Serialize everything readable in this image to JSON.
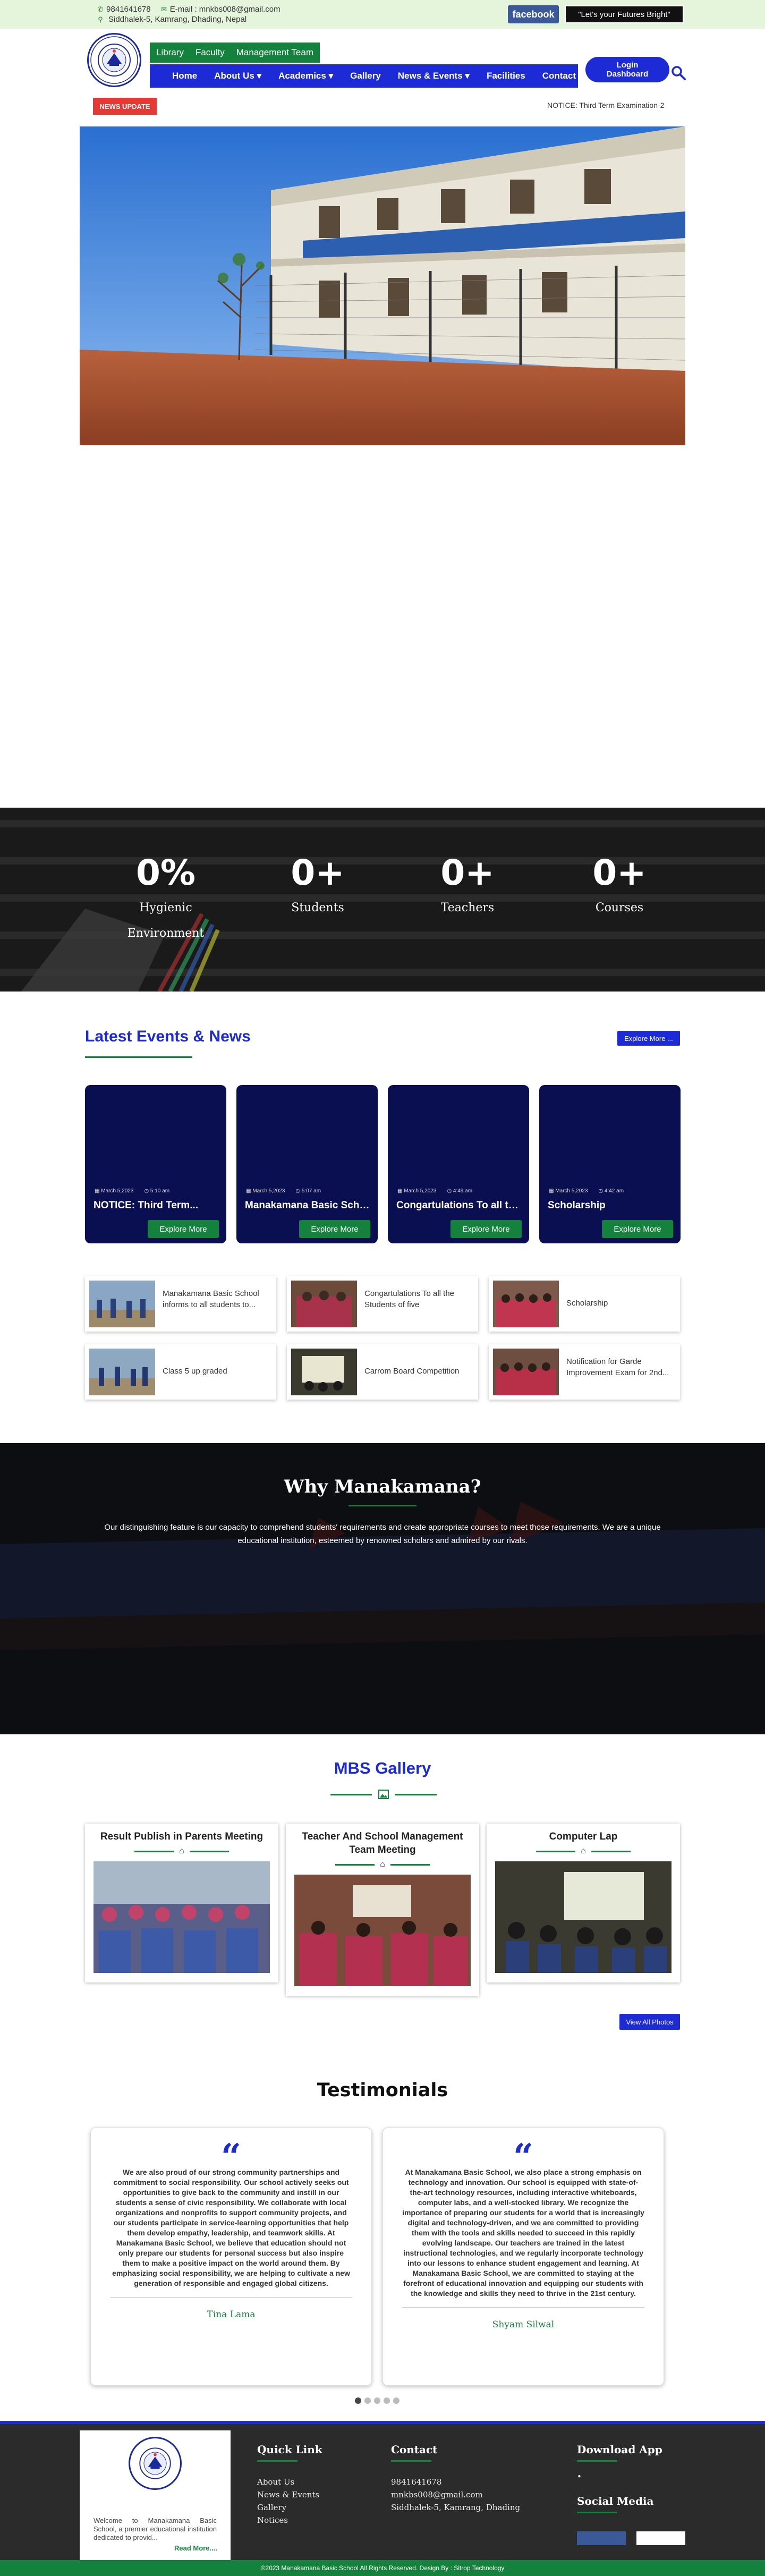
{
  "topbar": {
    "phone": "9841641678",
    "email": "E-mail : mnkbs008@gmail.com",
    "address": "Siddhalek-5, Kamrang, Dhading, Nepal",
    "facebook_label": "facebook",
    "slogan": "\"Let's your Futures Bright\""
  },
  "subnav": [
    "Library",
    "Faculty",
    "Management Team"
  ],
  "mainnav": [
    "Home",
    "About Us",
    "Academics",
    "Gallery",
    "News & Events",
    "Facilities",
    "Contact"
  ],
  "mainnav_dropdown_marker": "▾",
  "login_label": "Login Dashboard",
  "news": {
    "label": "NEWS UPDATE",
    "ticker": "NOTICE: Third Term Examination-2"
  },
  "stats": [
    {
      "value": "0%",
      "label": "Hygienic Environment"
    },
    {
      "value": "0+",
      "label": "Students"
    },
    {
      "value": "0+",
      "label": "Teachers"
    },
    {
      "value": "0+",
      "label": "Courses"
    }
  ],
  "events": {
    "title": "Latest Events & News",
    "explore_all": "Explore More ...",
    "cards": [
      {
        "date": "March 5,2023",
        "time": "5:10 am",
        "title": "NOTICE: Third Term...",
        "button": "Explore More"
      },
      {
        "date": "March 5,2023",
        "time": "5:07 am",
        "title": "Manakamana Basic School...",
        "button": "Explore More"
      },
      {
        "date": "March 5,2023",
        "time": "4:49 am",
        "title": "Congartulations To all the...",
        "button": "Explore More"
      },
      {
        "date": "March 5,2023",
        "time": "4:42 am",
        "title": "Scholarship",
        "button": "Explore More"
      }
    ],
    "mini": [
      "Manakamana Basic School informs to all students to...",
      "Congartulations To all the Students of five",
      "Scholarship",
      "Class 5 up graded",
      "Carrom Board Competition",
      "Notification for Garde Improvement Exam for 2nd..."
    ]
  },
  "why": {
    "title": "Why Manakamana?",
    "text": "Our distinguishing feature is our capacity to comprehend students' requirements and create appropriate courses to meet those requirements. We are a unique educational institution, esteemed by renowned scholars and admired by our rivals."
  },
  "gallery": {
    "title": "MBS Gallery",
    "cards": [
      "Result Publish in Parents Meeting",
      "Teacher And School Management Team Meeting",
      "Computer Lap"
    ],
    "view_all": "View All Photos"
  },
  "testimonials": {
    "title": "Testimonials",
    "items": [
      {
        "text": "We are also proud of our strong community partnerships and commitment to social responsibility. Our school actively seeks out opportunities to give back to the community and instill in our students a sense of civic responsibility. We collaborate with local organizations and nonprofits to support community projects, and our students participate in service-learning opportunities that help them develop empathy, leadership, and teamwork skills. At Manakamana Basic School, we believe that education should not only prepare our students for personal success but also inspire them to make a positive impact on the world around them. By emphasizing social responsibility, we are helping to cultivate a new generation of responsible and engaged global citizens.",
        "name": "Tina Lama"
      },
      {
        "text": "At Manakamana Basic School, we also place a strong emphasis on technology and innovation. Our school is equipped with state-of-the-art technology resources, including interactive whiteboards, computer labs, and a well-stocked library. We recognize the importance of preparing our students for a world that is increasingly digital and technology-driven, and we are committed to providing them with the tools and skills needed to succeed in this rapidly evolving landscape. Our teachers are trained in the latest instructional technologies, and we regularly incorporate technology into our lessons to enhance student engagement and learning. At Manakamana Basic School, we are committed to staying at the forefront of educational innovation and equipping our students with the knowledge and skills they need to thrive in the 21st century.",
        "name": "Shyam Silwal"
      }
    ]
  },
  "footer": {
    "about": "Welcome to Manakamana Basic School, a premier educational institution dedicated to provid...",
    "read_more": "Read More....",
    "quick_link_title": "Quick Link",
    "quick_links": [
      "About Us",
      "News & Events",
      "Gallery",
      "Notices"
    ],
    "contact_title": "Contact",
    "contact": [
      "9841641678",
      "mnkbs008@gmail.com",
      "Siddhalek-5, Kamrang, Dhading"
    ],
    "download_title": "Download App",
    "download_bullet": "•",
    "social_title": "Social Media",
    "copyright": "©2023 Manakamana Basic School All Rights Reserved. Design By : Sitrop Technology"
  },
  "colors": {
    "primary_blue": "#1c2bd6",
    "brand_green": "#14823c",
    "event_card_bg": "#0a0f52",
    "news_red": "#e53935"
  },
  "icons": {
    "phone": "phone-icon",
    "email": "email-icon",
    "location": "location-icon",
    "search": "search-icon",
    "calendar": "calendar-icon",
    "clock": "clock-icon",
    "quote": "quote-icon",
    "image": "image-icon"
  }
}
